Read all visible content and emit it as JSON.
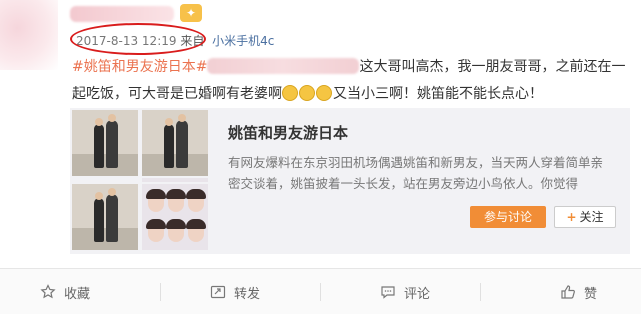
{
  "post": {
    "timestamp": "2017-8-13 12:19",
    "from_label": "来自",
    "device": "小米手机4c",
    "tag_prefix": "#姚笛和男友游日本#",
    "text_part1": "这大哥叫高杰，我一朋友哥哥，之前还在一起吃饭，可大哥是已婚啊有老婆啊",
    "text_part2": "又当小三啊！姚笛能不能长点心！"
  },
  "card": {
    "title": "姚笛和男友游日本",
    "description": "有网友爆料在东京羽田机场偶遇姚笛和新男友，当天两人穿着简单亲密交谈着，姚笛披着一头长发，站在男友旁边小鸟依人。你觉得",
    "discuss_label": "参与讨论",
    "follow_label": "关注",
    "follow_plus": "+"
  },
  "actions": {
    "favorite": "收藏",
    "repost": "转发",
    "comment": "评论",
    "like": "赞"
  },
  "colors": {
    "accent_orange": "#f18d36",
    "tag_color": "#eb7350",
    "highlight_circle": "#d91c1c"
  },
  "icons": [
    "star-icon",
    "repost-icon",
    "comment-icon",
    "thumbs-up-icon"
  ]
}
